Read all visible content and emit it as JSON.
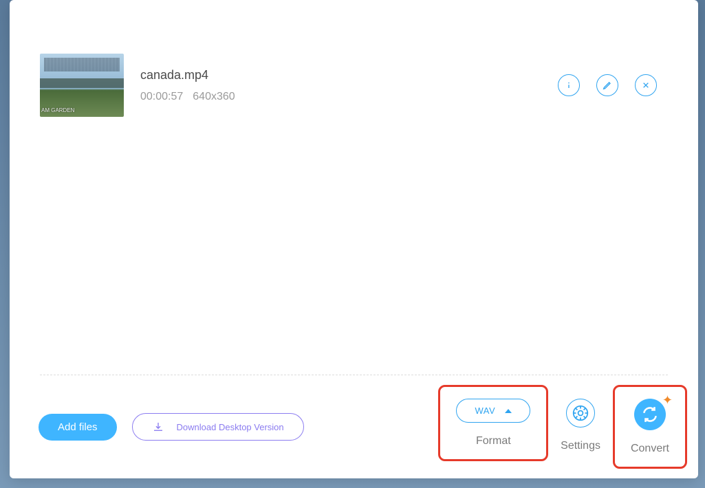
{
  "file": {
    "name": "canada.mp4",
    "duration": "00:00:57",
    "resolution": "640x360",
    "thumb_text": "AM\nGARDEN"
  },
  "actions": {
    "info_icon": "info-icon",
    "edit_icon": "edit-icon",
    "remove_icon": "close-icon"
  },
  "buttons": {
    "add_files": "Add files",
    "download_desktop": "Download Desktop Version"
  },
  "format": {
    "selected": "WAV",
    "label": "Format"
  },
  "settings": {
    "label": "Settings"
  },
  "convert": {
    "label": "Convert"
  },
  "colors": {
    "accent": "#2fa4f0",
    "highlight": "#e63a2a",
    "purple": "#8b7cf0",
    "orange_star": "#f08a2a"
  }
}
